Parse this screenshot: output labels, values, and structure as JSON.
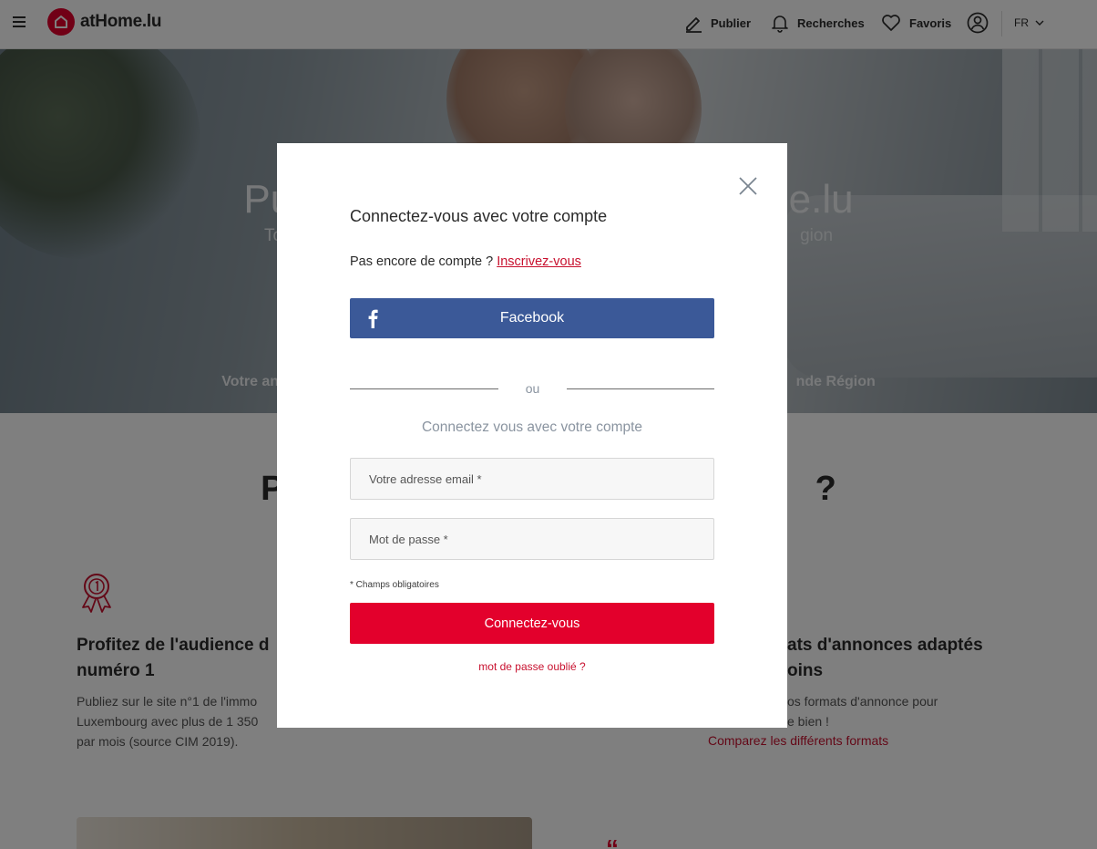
{
  "header": {
    "logo_text": "atHome.lu",
    "nav": {
      "publier": "Publier",
      "recherches": "Recherches",
      "favoris": "Favoris",
      "lang": "FR"
    }
  },
  "hero": {
    "title_left": "Pub",
    "title_right": "e.lu",
    "subtitle_left": "Touc",
    "subtitle_right": "gion",
    "tagline_left": "Votre anno",
    "tagline_right": "nde Région"
  },
  "main": {
    "section_title_left": "Po",
    "section_title_right": "?",
    "feature1": {
      "title_line1": "Profitez de l'audience d",
      "title_line2": "numéro 1",
      "desc_line1": "Publiez sur le site n°1 de l'immo",
      "desc_line2": "Luxembourg avec plus de 1 350",
      "desc_line3": "par mois (source CIM 2019)."
    },
    "feature3": {
      "title_line1": "ats d'annonces adaptés",
      "title_line2": "oins",
      "desc_line1": "os formats d'annonce pour",
      "desc_line2": "e bien !",
      "link": "Comparez les différents formats"
    }
  },
  "modal": {
    "title": "Connectez-vous avec votre compte",
    "no_account_text": "Pas encore de compte ?",
    "register_link": "Inscrivez-vous",
    "facebook_label": "Facebook",
    "or_text": "ou",
    "subtitle": "Connectez vous avec votre compte",
    "email_placeholder": "Votre adresse email *",
    "email_value": "",
    "password_placeholder": "Mot de passe *",
    "password_value": "",
    "required_note": "* Champs obligatoires",
    "submit_label": "Connectez-vous",
    "forgot_label": "mot de passe oublié ?"
  },
  "icons": {
    "menu": "hamburger-icon",
    "logo": "house-icon",
    "publier": "pencil-icon",
    "recherches": "bell-icon",
    "favoris": "heart-icon",
    "account": "user-circle-icon",
    "lang": "chevron-down-icon",
    "close": "close-icon",
    "facebook": "facebook-icon",
    "feature1": "award-ribbon-icon"
  },
  "colors": {
    "brand_red": "#e3002c",
    "link_red": "#c8102e",
    "facebook_blue": "#3b5998",
    "muted_text": "#8a94a0"
  }
}
